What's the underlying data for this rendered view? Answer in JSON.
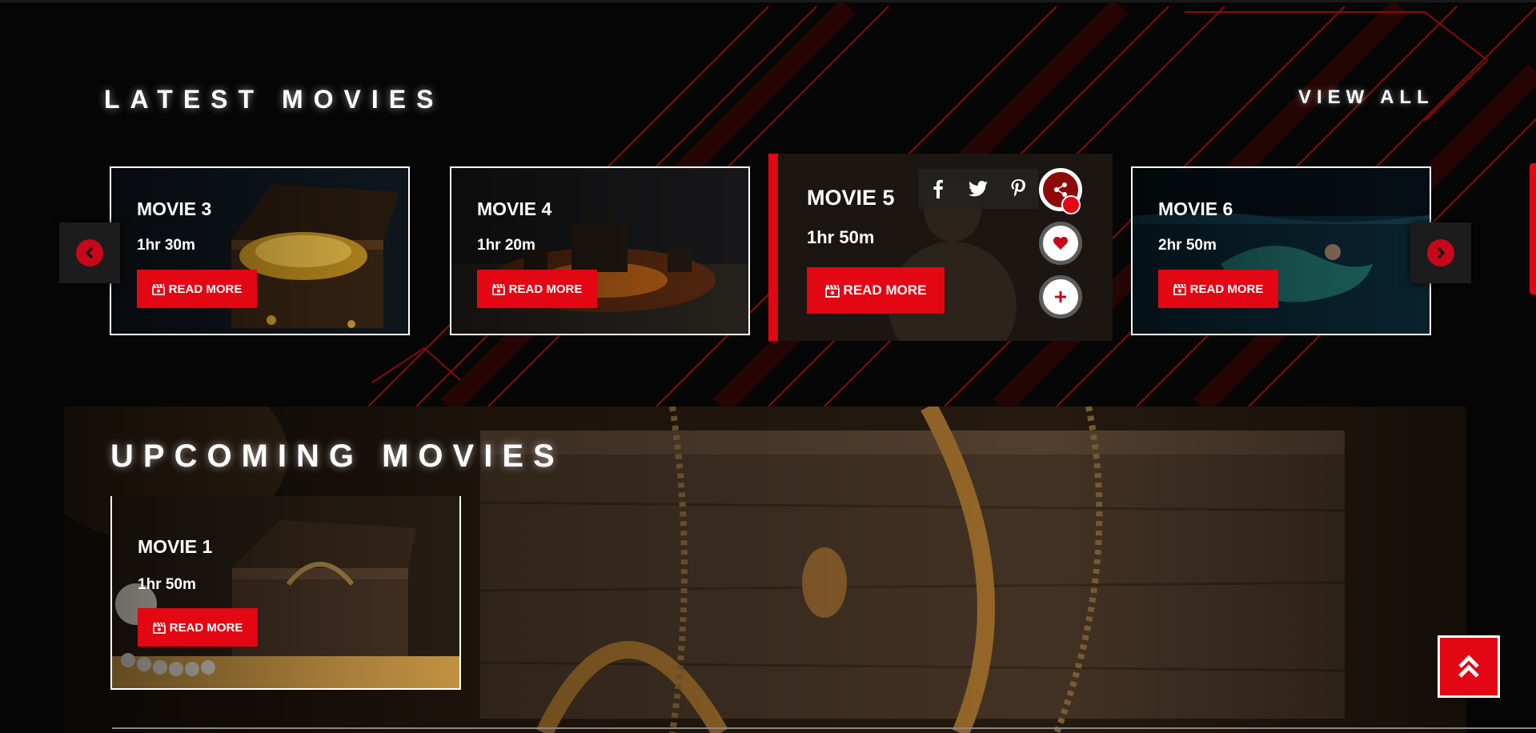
{
  "latest": {
    "title": "LATEST MOVIES",
    "view_all": "VIEW ALL",
    "movies": [
      {
        "title": "MOVIE 3",
        "duration": "1hr 30m",
        "button": "READ MORE"
      },
      {
        "title": "MOVIE 4",
        "duration": "1hr 20m",
        "button": "READ MORE"
      },
      {
        "title": "MOVIE 5",
        "duration": "1hr 50m",
        "button": "READ MORE"
      },
      {
        "title": "MOVIE 6",
        "duration": "2hr 50m",
        "button": "READ MORE"
      }
    ]
  },
  "upcoming": {
    "title": "UPCOMING MOVIES",
    "movies": [
      {
        "title": "MOVIE 1",
        "duration": "1hr 50m",
        "button": "READ MORE"
      }
    ]
  },
  "share_actions": [
    "facebook-icon",
    "twitter-icon",
    "pinterest-icon"
  ],
  "action_buttons": [
    "share-icon",
    "heart-icon",
    "plus-icon"
  ],
  "colors": {
    "accent": "#e30613",
    "background": "#050505",
    "text": "#ffffff"
  }
}
